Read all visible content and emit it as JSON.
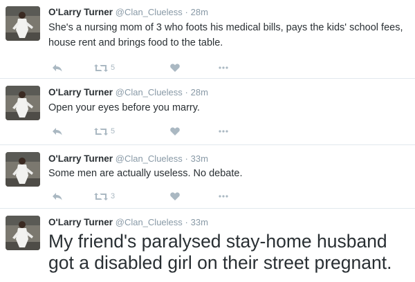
{
  "tweets": [
    {
      "name": "O'Larry Turner",
      "handle": "@Clan_Clueless",
      "separator": "·",
      "time": "28m",
      "text": "She's a nursing mom of 3 who foots his medical bills, pays the kids' school fees, house rent and brings food to the table.",
      "retweet_count": "5"
    },
    {
      "name": "O'Larry Turner",
      "handle": "@Clan_Clueless",
      "separator": "·",
      "time": "28m",
      "text": "Open your eyes before you marry.",
      "retweet_count": "5"
    },
    {
      "name": "O'Larry Turner",
      "handle": "@Clan_Clueless",
      "separator": "·",
      "time": "33m",
      "text": "Some men are actually useless. No debate.",
      "retweet_count": "3"
    },
    {
      "name": "O'Larry Turner",
      "handle": "@Clan_Clueless",
      "separator": "·",
      "time": "33m",
      "text": "My friend's paralysed stay-home husband got a disabled girl on their street pregnant."
    }
  ],
  "icons": {
    "reply": "reply-arrow-icon",
    "retweet": "retweet-icon",
    "like": "heart-icon",
    "more": "more-dots-icon"
  },
  "colors": {
    "name": "#292f33",
    "meta": "#8899a6",
    "action_icon": "#aab8c2",
    "divider": "#e1e8ed"
  }
}
